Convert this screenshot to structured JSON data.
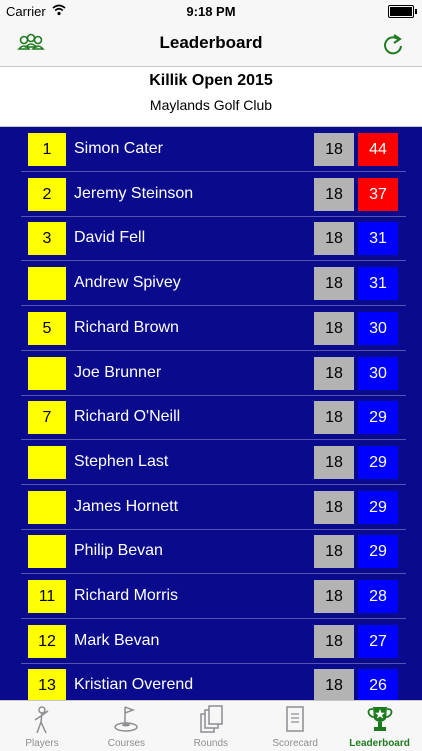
{
  "status_bar": {
    "carrier": "Carrier",
    "time": "9:18 PM"
  },
  "nav": {
    "title": "Leaderboard",
    "left_icon": "people-icon",
    "right_icon": "refresh-icon"
  },
  "event": {
    "name": "Killik Open 2015",
    "club": "Maylands Golf Club"
  },
  "colors": {
    "background": "#0a0a8c",
    "position_box": "#ffff00",
    "holes_box": "#b3b3b3",
    "points_high": "#ff0000",
    "points_normal": "#0000ff",
    "tab_active": "#1e7a1e"
  },
  "rows": [
    {
      "position": "1",
      "name": "Simon Cater",
      "holes": "18",
      "points": "44",
      "highlight": true
    },
    {
      "position": "2",
      "name": "Jeremy Steinson",
      "holes": "18",
      "points": "37",
      "highlight": true
    },
    {
      "position": "3",
      "name": "David Fell",
      "holes": "18",
      "points": "31",
      "highlight": false
    },
    {
      "position": "",
      "name": "Andrew Spivey",
      "holes": "18",
      "points": "31",
      "highlight": false
    },
    {
      "position": "5",
      "name": "Richard Brown",
      "holes": "18",
      "points": "30",
      "highlight": false
    },
    {
      "position": "",
      "name": "Joe Brunner",
      "holes": "18",
      "points": "30",
      "highlight": false
    },
    {
      "position": "7",
      "name": "Richard O'Neill",
      "holes": "18",
      "points": "29",
      "highlight": false
    },
    {
      "position": "",
      "name": "Stephen Last",
      "holes": "18",
      "points": "29",
      "highlight": false
    },
    {
      "position": "",
      "name": "James Hornett",
      "holes": "18",
      "points": "29",
      "highlight": false
    },
    {
      "position": "",
      "name": "Philip Bevan",
      "holes": "18",
      "points": "29",
      "highlight": false
    },
    {
      "position": "11",
      "name": "Richard Morris",
      "holes": "18",
      "points": "28",
      "highlight": false
    },
    {
      "position": "12",
      "name": "Mark Bevan",
      "holes": "18",
      "points": "27",
      "highlight": false
    },
    {
      "position": "13",
      "name": "Kristian Overend",
      "holes": "18",
      "points": "26",
      "highlight": false
    }
  ],
  "tabs": [
    {
      "label": "Players",
      "icon": "golfer-icon",
      "active": false
    },
    {
      "label": "Courses",
      "icon": "golf-hole-icon",
      "active": false
    },
    {
      "label": "Rounds",
      "icon": "cards-icon",
      "active": false
    },
    {
      "label": "Scorecard",
      "icon": "notebook-icon",
      "active": false
    },
    {
      "label": "Leaderboard",
      "icon": "trophy-icon",
      "active": true
    }
  ]
}
